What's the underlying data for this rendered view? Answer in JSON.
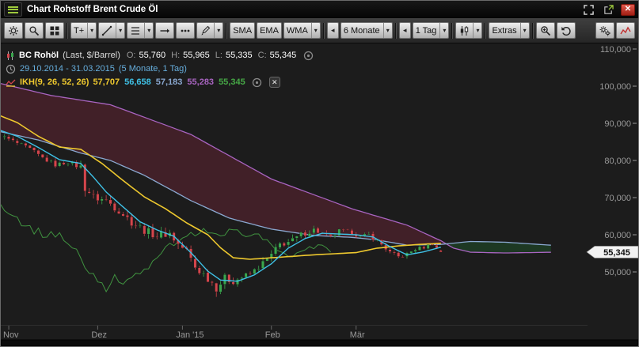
{
  "titlebar": {
    "title": "Chart Rohstoff Brent Crude Öl",
    "close_glyph": "✕"
  },
  "toolbar": {
    "dropdown_glyph": "▾",
    "back_glyph": "◂",
    "groups": [
      {
        "name": "chart-controls",
        "buttons": [
          {
            "name": "settings-button",
            "icon": "gear"
          },
          {
            "name": "zoom-mode-button",
            "icon": "magnifier"
          },
          {
            "name": "layout-grid-button",
            "icon": "grid"
          }
        ]
      },
      {
        "name": "draw-tools",
        "buttons": [
          {
            "name": "text-tool-button",
            "label": "T+",
            "dropdown": true
          },
          {
            "name": "trendline-tool-button",
            "icon": "line",
            "dropdown": true
          },
          {
            "name": "fibonacci-tool-button",
            "icon": "fib",
            "dropdown": true
          },
          {
            "name": "horizontal-line-tool-button",
            "icon": "hline"
          },
          {
            "name": "point-marker-tool-button",
            "icon": "dots"
          },
          {
            "name": "freehand-tool-button",
            "icon": "pencil",
            "dropdown": true
          }
        ]
      },
      {
        "name": "averages",
        "buttons": [
          {
            "name": "sma-button",
            "label": "SMA"
          },
          {
            "name": "ema-button",
            "label": "EMA"
          },
          {
            "name": "wma-button",
            "label": "WMA",
            "dropdown": true
          }
        ]
      },
      {
        "name": "period",
        "buttons": [
          {
            "name": "period-back-button",
            "back": true
          },
          {
            "name": "period-select",
            "label": "6 Monate",
            "dropdown": true
          }
        ]
      },
      {
        "name": "interval",
        "buttons": [
          {
            "name": "interval-back-button",
            "back": true
          },
          {
            "name": "interval-select",
            "label": "1 Tag",
            "dropdown": true
          }
        ]
      },
      {
        "name": "chart-type",
        "buttons": [
          {
            "name": "chart-type-select",
            "icon": "candles",
            "dropdown": true
          }
        ]
      },
      {
        "name": "extras",
        "buttons": [
          {
            "name": "extras-button",
            "label": "Extras",
            "dropdown": true
          }
        ]
      },
      {
        "name": "zoom-history",
        "buttons": [
          {
            "name": "zoom-in-button",
            "icon": "zoomplus"
          },
          {
            "name": "undo-button",
            "icon": "undo"
          }
        ]
      },
      {
        "name": "right-tools",
        "right": true,
        "buttons": [
          {
            "name": "chart-settings-button",
            "icon": "gears"
          },
          {
            "name": "mini-chart-button",
            "icon": "curve"
          }
        ]
      }
    ]
  },
  "legend": {
    "series": {
      "name": "BC Rohöl",
      "type": "(Last, $/Barrel)",
      "fields": [
        {
          "label": "O:",
          "value": "55,760"
        },
        {
          "label": "H:",
          "value": "55,965"
        },
        {
          "label": "L:",
          "value": "55,335"
        },
        {
          "label": "C:",
          "value": "55,345"
        }
      ]
    },
    "range": {
      "text": "29.10.2014 - 31.03.2015",
      "suffix": "(5 Monate, 1 Tag)"
    },
    "indicator": {
      "name": "IKH(9, 26, 52, 26)",
      "close_glyph": "✕",
      "values": [
        {
          "series": "kijun",
          "text": "57,707"
        },
        {
          "series": "tenkan",
          "text": "56,658"
        },
        {
          "series": "senkou_a",
          "text": "57,183"
        },
        {
          "series": "senkou_b",
          "text": "55,283"
        },
        {
          "series": "chikou",
          "text": "55,345"
        }
      ]
    }
  },
  "colors": {
    "kijun": "#eec82e",
    "tenkan": "#3fc1e6",
    "senkou_a": "#8aa8d0",
    "senkou_b": "#a864c0",
    "chikou": "#46a846",
    "up": "#3aa64e",
    "down": "#d4454c",
    "cloud_bear": "#432129",
    "cloud_bull": "#1d3a24",
    "range_text": "#66aedd",
    "axis_text": "#999999",
    "bg": "#1c1c1c"
  },
  "chart_data": {
    "type": "candlestick",
    "title": "BC Rohöl (Last, $/Barrel)",
    "period": "6 Monate",
    "interval": "1 Tag",
    "date_range": "29.10.2014 - 31.03.2015",
    "ohlc_last": {
      "o": 55.76,
      "h": 55.965,
      "l": 55.335,
      "c": 55.345
    },
    "bars": 106,
    "cloud_extend": 131,
    "y_axis": {
      "ticks": [
        {
          "value": 110,
          "label": "110,000"
        },
        {
          "value": 100,
          "label": "100,000"
        },
        {
          "value": 90,
          "label": "90,000"
        },
        {
          "value": 80,
          "label": "80,000"
        },
        {
          "value": 70,
          "label": "70,000"
        },
        {
          "value": 60,
          "label": "60,000"
        },
        {
          "value": 50,
          "label": "50,000"
        }
      ]
    },
    "x_ticks": [
      {
        "idx": 3,
        "label": "Nov"
      },
      {
        "idx": 24,
        "label": "Dez"
      },
      {
        "idx": 44,
        "label": "Jan '15"
      },
      {
        "idx": 65,
        "label": "Feb"
      },
      {
        "idx": 85,
        "label": "Mär"
      }
    ],
    "price_tag": {
      "value": 55.345,
      "label": "55,345"
    },
    "close_anchors": [
      [
        0,
        87.0
      ],
      [
        2,
        86.2
      ],
      [
        5,
        84.6
      ],
      [
        8,
        83.0
      ],
      [
        11,
        80.6
      ],
      [
        14,
        78.8
      ],
      [
        17,
        79.6
      ],
      [
        20,
        78.2
      ],
      [
        21,
        72.8
      ],
      [
        23,
        70.2
      ],
      [
        26,
        69.2
      ],
      [
        29,
        66.6
      ],
      [
        32,
        63.4
      ],
      [
        35,
        61.2
      ],
      [
        38,
        59.8
      ],
      [
        41,
        60.4
      ],
      [
        43,
        57.4
      ],
      [
        45,
        55.6
      ],
      [
        47,
        51.2
      ],
      [
        50,
        48.4
      ],
      [
        52,
        45.9
      ],
      [
        54,
        48.2
      ],
      [
        56,
        47.6
      ],
      [
        58,
        48.6
      ],
      [
        60,
        49.4
      ],
      [
        63,
        52.4
      ],
      [
        65,
        54.6
      ],
      [
        67,
        57.4
      ],
      [
        70,
        58.4
      ],
      [
        72,
        60.0
      ],
      [
        75,
        61.4
      ],
      [
        77,
        60.2
      ],
      [
        79,
        59.2
      ],
      [
        81,
        61.0
      ],
      [
        84,
        60.6
      ],
      [
        86,
        59.4
      ],
      [
        88,
        60.0
      ],
      [
        90,
        58.4
      ],
      [
        93,
        55.2
      ],
      [
        95,
        54.0
      ],
      [
        97,
        54.8
      ],
      [
        99,
        56.2
      ],
      [
        101,
        56.6
      ],
      [
        103,
        57.6
      ],
      [
        104,
        56.4
      ],
      [
        105,
        55.345
      ]
    ],
    "volatility_anchors": [
      [
        0,
        1.0
      ],
      [
        18,
        1.1
      ],
      [
        21,
        2.4
      ],
      [
        30,
        1.9
      ],
      [
        44,
        2.1
      ],
      [
        52,
        2.3
      ],
      [
        60,
        1.5
      ],
      [
        68,
        1.7
      ],
      [
        80,
        1.1
      ],
      [
        95,
        1.0
      ],
      [
        105,
        0.8
      ]
    ],
    "indicator": {
      "name": "IKH",
      "params": [
        9,
        26,
        52,
        26
      ],
      "chikou_shift": 26,
      "kijun_anchors": [
        [
          0,
          92.5
        ],
        [
          5,
          90.2
        ],
        [
          10,
          86.5
        ],
        [
          15,
          83.6
        ],
        [
          20,
          83.0
        ],
        [
          25,
          79.2
        ],
        [
          30,
          74.6
        ],
        [
          35,
          70.2
        ],
        [
          40,
          67.0
        ],
        [
          45,
          63.2
        ],
        [
          50,
          60.0
        ],
        [
          53,
          56.5
        ],
        [
          56,
          53.8
        ],
        [
          60,
          53.4
        ],
        [
          65,
          53.8
        ],
        [
          70,
          54.2
        ],
        [
          75,
          54.6
        ],
        [
          80,
          54.9
        ],
        [
          85,
          55.2
        ],
        [
          90,
          56.4
        ],
        [
          95,
          57.0
        ],
        [
          100,
          57.4
        ],
        [
          105,
          57.707
        ]
      ],
      "tenkan_anchors": [
        [
          0,
          88.5
        ],
        [
          5,
          86.5
        ],
        [
          10,
          83.5
        ],
        [
          15,
          80.2
        ],
        [
          20,
          79.2
        ],
        [
          23,
          75.5
        ],
        [
          26,
          71.5
        ],
        [
          30,
          67.5
        ],
        [
          34,
          63.5
        ],
        [
          38,
          61.3
        ],
        [
          42,
          59.6
        ],
        [
          46,
          55.2
        ],
        [
          50,
          50.2
        ],
        [
          53,
          47.8
        ],
        [
          57,
          47.5
        ],
        [
          61,
          49.2
        ],
        [
          65,
          52.2
        ],
        [
          69,
          56.4
        ],
        [
          73,
          59.0
        ],
        [
          77,
          60.4
        ],
        [
          81,
          60.2
        ],
        [
          85,
          60.0
        ],
        [
          89,
          59.4
        ],
        [
          93,
          56.8
        ],
        [
          97,
          54.6
        ],
        [
          101,
          55.4
        ],
        [
          105,
          56.658
        ]
      ],
      "senkou_a_anchors": [
        [
          0,
          88.0
        ],
        [
          10,
          85.5
        ],
        [
          20,
          82.0
        ],
        [
          27,
          80.0
        ],
        [
          35,
          76.0
        ],
        [
          46,
          69.2
        ],
        [
          55,
          64.5
        ],
        [
          65,
          61.5
        ],
        [
          75,
          59.8
        ],
        [
          84,
          59.3
        ],
        [
          90,
          58.6
        ],
        [
          97,
          57.2
        ],
        [
          105,
          57.4
        ],
        [
          112,
          58.2
        ],
        [
          120,
          58.0
        ],
        [
          131,
          57.183
        ]
      ],
      "senkou_b_anchors": [
        [
          0,
          101.0
        ],
        [
          13,
          97.5
        ],
        [
          27,
          95.0
        ],
        [
          46,
          87.0
        ],
        [
          65,
          75.0
        ],
        [
          84,
          67.0
        ],
        [
          97,
          62.6
        ],
        [
          105,
          58.4
        ],
        [
          108,
          56.4
        ],
        [
          112,
          55.3
        ],
        [
          120,
          55.1
        ],
        [
          131,
          55.283
        ]
      ]
    }
  }
}
